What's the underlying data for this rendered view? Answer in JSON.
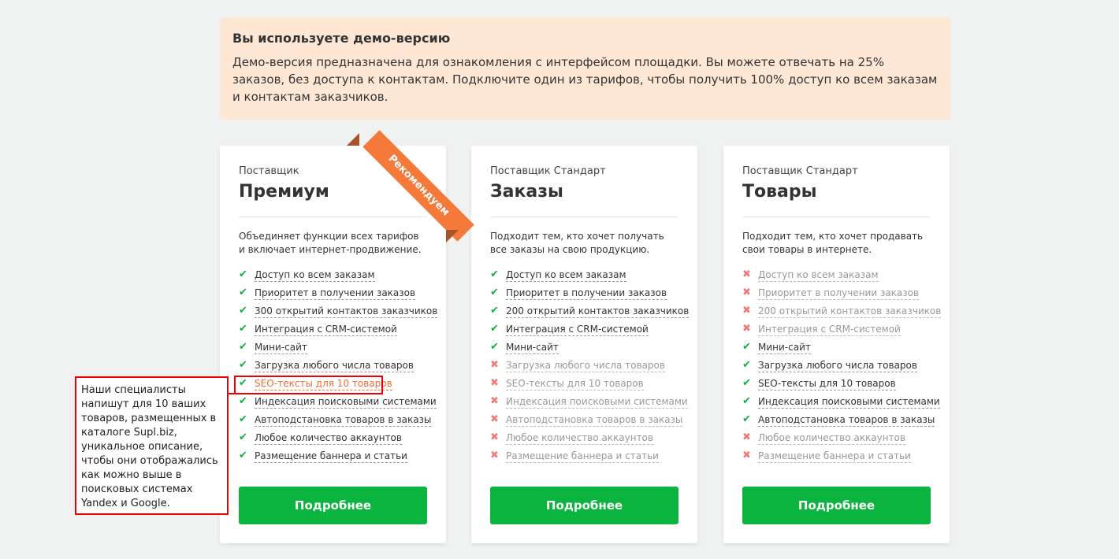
{
  "demo": {
    "title": "Вы используете демо-версию",
    "text": "Демо-версия предназначена для ознакомления с интерфейсом площадки. Вы можете отвечать на 25% заказов, без доступа к контактам. Подключите один из тарифов, чтобы получить 100% доступ ко всем заказам и контактам заказчиков."
  },
  "ribbon": {
    "label": "Рекомендуем",
    "color": "#f57a3a"
  },
  "colors": {
    "button": "#0ab43f",
    "check": "#11b13e",
    "cross": "#ef7b7b",
    "accent": "#f26c3b",
    "banner": "#ffe7d6"
  },
  "plans": [
    {
      "subtitle": "Поставщик",
      "title": "Премиум",
      "description": "Объединяет функции всех тарифов и включает интернет-продвижение.",
      "button": "Подробнее",
      "features": [
        {
          "label": "Доступ ко всем заказам",
          "included": true
        },
        {
          "label": "Приоритет в получении заказов",
          "included": true
        },
        {
          "label": "300 открытий контактов заказчиков",
          "included": true
        },
        {
          "label": "Интеграция с CRM-системой",
          "included": true
        },
        {
          "label": "Мини-сайт",
          "included": true
        },
        {
          "label": "Загрузка любого числа товаров",
          "included": true
        },
        {
          "label": "SEO-тексты для 10 товаров",
          "included": true,
          "highlighted": true
        },
        {
          "label": "Индексация поисковыми системами",
          "included": true
        },
        {
          "label": "Автоподстановка товаров в заказы",
          "included": true
        },
        {
          "label": "Любое количество аккаунтов",
          "included": true
        },
        {
          "label": "Размещение баннера и статьи",
          "included": true
        }
      ]
    },
    {
      "subtitle": "Поставщик Стандарт",
      "title": "Заказы",
      "description": "Подходит тем, кто хочет получать все заказы на свою продукцию.",
      "button": "Подробнее",
      "features": [
        {
          "label": "Доступ ко всем заказам",
          "included": true
        },
        {
          "label": "Приоритет в получении заказов",
          "included": true
        },
        {
          "label": "200 открытий контактов заказчиков",
          "included": true
        },
        {
          "label": "Интеграция с CRM-системой",
          "included": true
        },
        {
          "label": "Мини-сайт",
          "included": true
        },
        {
          "label": "Загрузка любого числа товаров",
          "included": false
        },
        {
          "label": "SEO-тексты для 10 товаров",
          "included": false
        },
        {
          "label": "Индексация поисковыми системами",
          "included": false
        },
        {
          "label": "Автоподстановка товаров в заказы",
          "included": false
        },
        {
          "label": "Любое количество аккаунтов",
          "included": false
        },
        {
          "label": "Размещение баннера и статьи",
          "included": false
        }
      ]
    },
    {
      "subtitle": "Поставщик Стандарт",
      "title": "Товары",
      "description": "Подходит тем, кто хочет продавать свои товары в интернете.",
      "button": "Подробнее",
      "features": [
        {
          "label": "Доступ ко всем заказам",
          "included": false
        },
        {
          "label": "Приоритет в получении заказов",
          "included": false
        },
        {
          "label": "200 открытий контактов заказчиков",
          "included": false
        },
        {
          "label": "Интеграция с CRM-системой",
          "included": false
        },
        {
          "label": "Мини-сайт",
          "included": true
        },
        {
          "label": "Загрузка любого числа товаров",
          "included": true
        },
        {
          "label": "SEO-тексты для 10 товаров",
          "included": true
        },
        {
          "label": "Индексация поисковыми системами",
          "included": true
        },
        {
          "label": "Автоподстановка товаров в заказы",
          "included": true
        },
        {
          "label": "Любое количество аккаунтов",
          "included": false
        },
        {
          "label": "Размещение баннера и статьи",
          "included": false
        }
      ]
    }
  ],
  "tooltip": {
    "text": "Наши специалисты напишут для 10 ваших товаров, размещенных в каталоге Supl.biz, уникальное описание, чтобы они отображались как можно выше в поисковых системах Yandex и Google."
  }
}
